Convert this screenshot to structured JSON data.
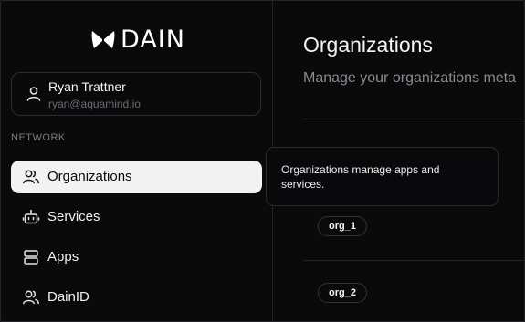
{
  "brand": {
    "logo_text": "DAIN"
  },
  "user": {
    "name": "Ryan Trattner",
    "email": "ryan@aquamind.io"
  },
  "sidebar": {
    "section_label": "NETWORK",
    "items": [
      {
        "label": "Organizations",
        "icon": "users-icon",
        "active": true
      },
      {
        "label": "Services",
        "icon": "robot-icon",
        "active": false
      },
      {
        "label": "Apps",
        "icon": "server-icon",
        "active": false
      },
      {
        "label": "DainID",
        "icon": "users-icon",
        "active": false
      }
    ]
  },
  "main": {
    "title": "Organizations",
    "subtitle": "Manage your organizations meta",
    "tooltip": "Organizations manage apps and services.",
    "orgs": [
      {
        "name": "org_1"
      },
      {
        "name": "org_2"
      }
    ]
  },
  "colors": {
    "active_bg": "#f2f2f2",
    "background": "#0a0a0b"
  }
}
